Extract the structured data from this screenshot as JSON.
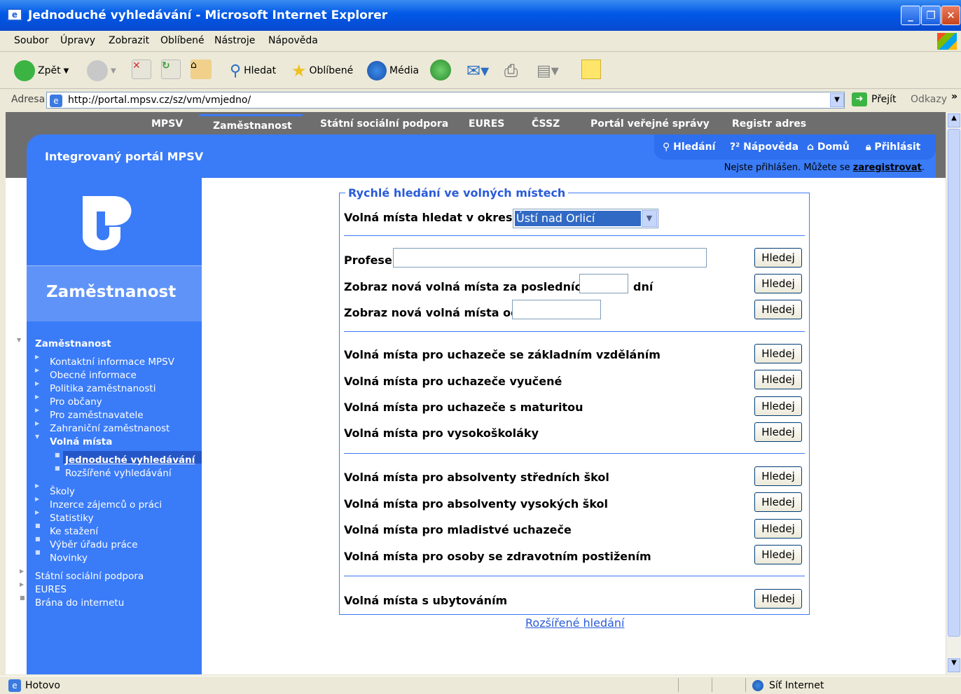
{
  "window": {
    "title": "Jednoduché vyhledávání - Microsoft Internet Explorer"
  },
  "menu": [
    "Soubor",
    "Úpravy",
    "Zobrazit",
    "Oblíbené",
    "Nástroje",
    "Nápověda"
  ],
  "toolbar": {
    "back": "Zpět",
    "search": "Hledat",
    "favorites": "Oblíbené",
    "media": "Média"
  },
  "address": {
    "label": "Adresa",
    "url": "http://portal.mpsv.cz/sz/vm/vmjedno/",
    "go": "Přejít",
    "links": "Odkazy"
  },
  "status": {
    "left": "Hotovo",
    "zone": "Síť Internet"
  },
  "topnav": [
    "MPSV",
    "Zaměstnanost",
    "Státní sociální podpora",
    "EURES",
    "ČSSZ",
    "Portál veřejné správy",
    "Registr adres"
  ],
  "header": {
    "portal": "Integrovaný portál MPSV",
    "util": {
      "search": "Hledání",
      "help": "Nápověda",
      "home": "Domů",
      "login": "Přihlásit"
    },
    "login_text": "Nejste přihlášen. Můžete se",
    "register": "zaregistrovat"
  },
  "section": "Zaměstnanost",
  "leftmenu": {
    "title": "Zaměstnanost",
    "items": [
      "Kontaktní informace MPSV",
      "Obecné informace",
      "Politika zaměstnanosti",
      "Pro občany",
      "Pro zaměstnavatele",
      "Zahraniční zaměstnanost"
    ],
    "volna": "Volná místa",
    "sub": [
      "Jednoduché vyhledávání",
      "Rozšířené vyhledávání"
    ],
    "items2": [
      "Školy",
      "Inzerce zájemců o práci",
      "Statistiky",
      "Ke stažení",
      "Výběr úřadu práce",
      "Novinky"
    ],
    "bottom": [
      "Státní sociální podpora",
      "EURES",
      "Brána do internetu"
    ]
  },
  "form": {
    "legend": "Rychlé hledání ve volných místech",
    "district_label": "Volná místa hledat v okrese",
    "district_value": "Ústí nad Orlicí",
    "profese": "Profese",
    "days_label": "Zobraz nová volná místa za posledních",
    "days_unit": "dní",
    "from_label": "Zobraz nová volná místa od",
    "rows": [
      "Volná místa pro uchazeče se základním vzděláním",
      "Volná místa pro uchazeče vyučené",
      "Volná místa pro uchazeče s maturitou",
      "Volná místa pro vysokoškoláky",
      "Volná místa pro absolventy středních škol",
      "Volná místa pro absolventy vysokých škol",
      "Volná místa pro mladistvé uchazeče",
      "Volná místa pro osoby se zdravotním postižením",
      "Volná místa s ubytováním"
    ],
    "button": "Hledej",
    "advanced": "Rozšířené hledání"
  }
}
